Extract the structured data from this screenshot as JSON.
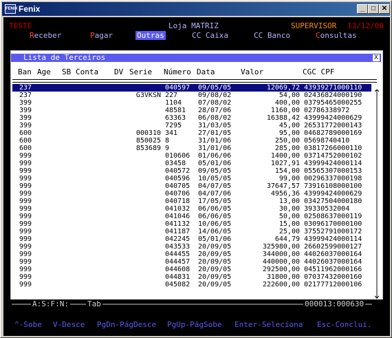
{
  "window": {
    "title": "Fenix",
    "icon_text": "FENIX",
    "btn_min": "_",
    "btn_max": "□",
    "btn_close": "✕"
  },
  "topbar": {
    "left": "TESTE",
    "center": "Loja MATRIZ",
    "user": "SUPERVISOR",
    "date": "13/12/06"
  },
  "menu": [
    {
      "hotkey": "R",
      "rest": "eceber"
    },
    {
      "hotkey": "P",
      "rest": "agar"
    },
    {
      "label": "Outras",
      "active": true
    },
    {
      "text": "CC Caixa"
    },
    {
      "text": "CC Banco"
    },
    {
      "hotkey": "C",
      "rest": "onsultas"
    }
  ],
  "panel": {
    "title": "Lista de Terceiros",
    "close": "X",
    "headers": {
      "ban": "Ban",
      "age": "Age",
      "sb": "SB",
      "conta": "Conta",
      "dv": "DV",
      "serie": "Serie",
      "numero": "Número",
      "data": "Data",
      "valor": "Valor",
      "cgc": "CGC CPF"
    },
    "rows": [
      [
        "237",
        "",
        "040597",
        "09/05/05",
        "12069,72",
        "43939271000110"
      ],
      [
        "237",
        "G3VKSN",
        "227",
        "09/08/02",
        "54,00",
        "02436824000190"
      ],
      [
        "399",
        "",
        "1104",
        "07/08/02",
        "400,00",
        "03795465000255"
      ],
      [
        "399",
        "",
        "48581",
        "28/07/06",
        "1160,00",
        "02786338972"
      ],
      [
        "399",
        "",
        "63363",
        "06/08/02",
        "16388,42",
        "43999424000629"
      ],
      [
        "399",
        "",
        "7295",
        "31/03/05",
        "45,00",
        "26531772000143"
      ],
      [
        "600",
        "000310",
        "341",
        "27/01/05",
        "95,00",
        "04682789000169"
      ],
      [
        "600",
        "850025",
        "8",
        "31/01/06",
        "250,00",
        "05698740410"
      ],
      [
        "600",
        "853689",
        "9",
        "31/01/06",
        "285,00",
        "03817266000110"
      ],
      [
        "999",
        "",
        "010606",
        "01/06/06",
        "1400,00",
        "03714752000102"
      ],
      [
        "999",
        "",
        "03458",
        "05/01/06",
        "1027,91",
        "43999424000114"
      ],
      [
        "999",
        "",
        "040572",
        "09/05/05",
        "154,00",
        "05565307000153"
      ],
      [
        "999",
        "",
        "040596",
        "10/05/05",
        "99,00",
        "00296337000198"
      ],
      [
        "999",
        "",
        "040705",
        "04/07/05",
        "37647,57",
        "73916108000100"
      ],
      [
        "999",
        "",
        "040706",
        "04/07/06",
        "4956,36",
        "43999424000629"
      ],
      [
        "999",
        "",
        "040718",
        "17/05/05",
        "13,00",
        "03427504000180"
      ],
      [
        "999",
        "",
        "041032",
        "06/06/05",
        "30,00",
        "39330532004"
      ],
      [
        "999",
        "",
        "041046",
        "06/06/05",
        "50,00",
        "02508637000119"
      ],
      [
        "999",
        "",
        "041132",
        "10/06/05",
        "15,00",
        "03096170000100"
      ],
      [
        "999",
        "",
        "041187",
        "14/06/05",
        "25,00",
        "37552791000172"
      ],
      [
        "999",
        "",
        "042245",
        "05/01/06",
        "644,79",
        "43999424000114"
      ],
      [
        "999",
        "",
        "043533",
        "20/09/05",
        "325980,00",
        "26602599000127"
      ],
      [
        "999",
        "",
        "044455",
        "20/09/05",
        "344000,00",
        "44026037000164"
      ],
      [
        "999",
        "",
        "044457",
        "20/09/05",
        "440000,00",
        "44026037000164"
      ],
      [
        "999",
        "",
        "044608",
        "20/09/05",
        "292500,00",
        "04511962000166"
      ],
      [
        "999",
        "",
        "044831",
        "20/09/05",
        "31800,00",
        "07037432000160"
      ],
      [
        "999",
        "",
        "045082",
        "20/09/05",
        "222600,00",
        "02177712000106"
      ]
    ]
  },
  "status": {
    "keys": "A:S:F:N:",
    "tab": "Tab",
    "counter": "000013:000630"
  },
  "footer": [
    "^-Sobe",
    "V-Desce",
    "PgDn-PágDesce",
    "PgUp-PágSobe",
    "Enter-Seleciona",
    "Esc-Conclui."
  ],
  "colors": {
    "title_gradient_start": "#0a246a",
    "title_gradient_end": "#3a6ea5",
    "selected_row": "#0a0a82",
    "menu_active": "#5a5af0",
    "panel_title": "#5a5af0"
  }
}
